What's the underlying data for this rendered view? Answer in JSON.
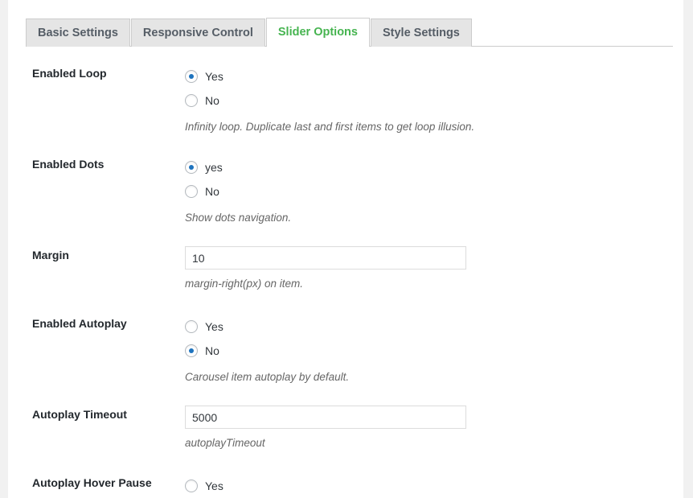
{
  "tabs": [
    {
      "label": "Basic Settings",
      "active": false
    },
    {
      "label": "Responsive Control",
      "active": false
    },
    {
      "label": "Slider Options",
      "active": true
    },
    {
      "label": "Style Settings",
      "active": false
    }
  ],
  "colors": {
    "active_tab_text": "#46b450",
    "inactive_tab_text": "#555d66",
    "inactive_tab_bg": "#e5e5e5",
    "radio_dot": "#1e73be",
    "label_text": "#23282d",
    "description_text": "#666666",
    "page_background": "#f1f1f1",
    "panel_background": "#ffffff",
    "border": "#cccccc",
    "input_border": "#dddddd"
  },
  "rows": [
    {
      "label": "Enabled Loop",
      "type": "radio",
      "options": [
        {
          "label": "Yes",
          "checked": true
        },
        {
          "label": "No",
          "checked": false
        }
      ],
      "description": "Infinity loop. Duplicate last and first items to get loop illusion."
    },
    {
      "label": "Enabled Dots",
      "type": "radio",
      "options": [
        {
          "label": "yes",
          "checked": true
        },
        {
          "label": "No",
          "checked": false
        }
      ],
      "description": "Show dots navigation."
    },
    {
      "label": "Margin",
      "type": "text",
      "value": "10",
      "placeholder": "",
      "description": "margin-right(px) on item."
    },
    {
      "label": "Enabled Autoplay",
      "type": "radio",
      "options": [
        {
          "label": "Yes",
          "checked": false
        },
        {
          "label": "No",
          "checked": true
        }
      ],
      "description": "Carousel item autoplay by default."
    },
    {
      "label": "Autoplay Timeout",
      "type": "text",
      "value": "5000",
      "placeholder": "",
      "description": "autoplayTimeout"
    },
    {
      "label": "Autoplay Hover Pause",
      "type": "radio",
      "options": [
        {
          "label": "Yes",
          "checked": false
        }
      ],
      "description": ""
    }
  ]
}
